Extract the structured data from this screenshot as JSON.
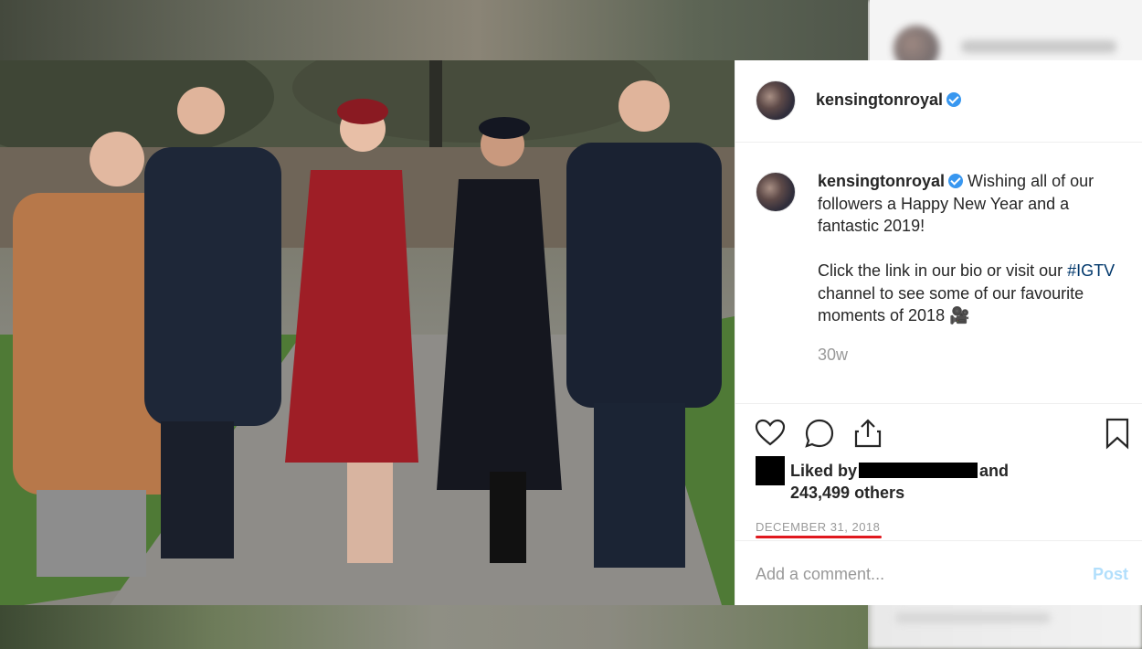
{
  "post": {
    "username": "kensingtonroyal",
    "caption_line1": "Wishing all of our followers a Happy New Year and a fantastic 2019!",
    "caption_line2_prefix": "Click the link in our bio or visit our ",
    "hashtag": "#IGTV",
    "caption_line2_suffix": " channel to see some of our favourite moments of 2018 🎥",
    "age": "30w",
    "liked_by_prefix": "Liked by",
    "liked_by_and": "and",
    "liked_by_count": "243,499 others",
    "date": "DECEMBER 31, 2018",
    "comment_placeholder": "Add a comment...",
    "post_label": "Post"
  },
  "icons": {
    "like": "heart-icon",
    "comment": "comment-icon",
    "share": "share-icon",
    "save": "bookmark-icon",
    "verified": "verified-badge-icon"
  },
  "colors": {
    "verified": "#3897f0",
    "date_underline": "#e0181e",
    "post_button": "#b2dffc",
    "muted_text": "#999999",
    "text": "#262626"
  }
}
